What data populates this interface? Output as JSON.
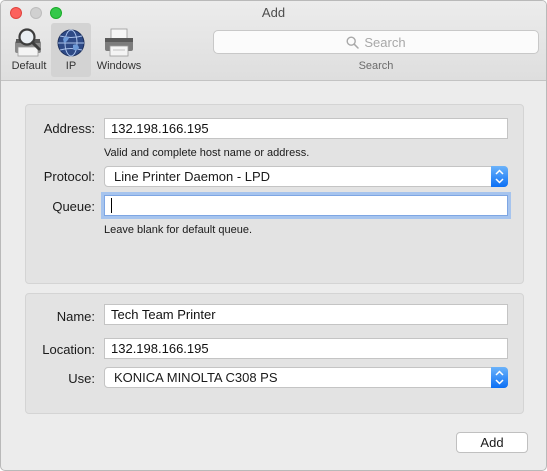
{
  "window": {
    "title": "Add"
  },
  "toolbar": {
    "items": [
      {
        "label": "Default",
        "icon": "magnifier-printer-icon",
        "selected": false
      },
      {
        "label": "IP",
        "icon": "globe-icon",
        "selected": true
      },
      {
        "label": "Windows",
        "icon": "printer-icon",
        "selected": false
      }
    ],
    "search": {
      "placeholder": "Search",
      "caption": "Search"
    }
  },
  "connection": {
    "address_label": "Address:",
    "address_value": "132.198.166.195",
    "address_hint": "Valid and complete host name or address.",
    "protocol_label": "Protocol:",
    "protocol_value": "Line Printer Daemon - LPD",
    "queue_label": "Queue:",
    "queue_value": "",
    "queue_hint": "Leave blank for default queue."
  },
  "details": {
    "name_label": "Name:",
    "name_value": "Tech Team Printer",
    "location_label": "Location:",
    "location_value": "132.198.166.195",
    "use_label": "Use:",
    "use_value": "KONICA MINOLTA C308 PS"
  },
  "footer": {
    "add_label": "Add"
  },
  "colors": {
    "accent": "#0b6ff5",
    "focus_ring": "#a6c4ee",
    "close": "#fc615d",
    "zoom": "#34c84a"
  }
}
